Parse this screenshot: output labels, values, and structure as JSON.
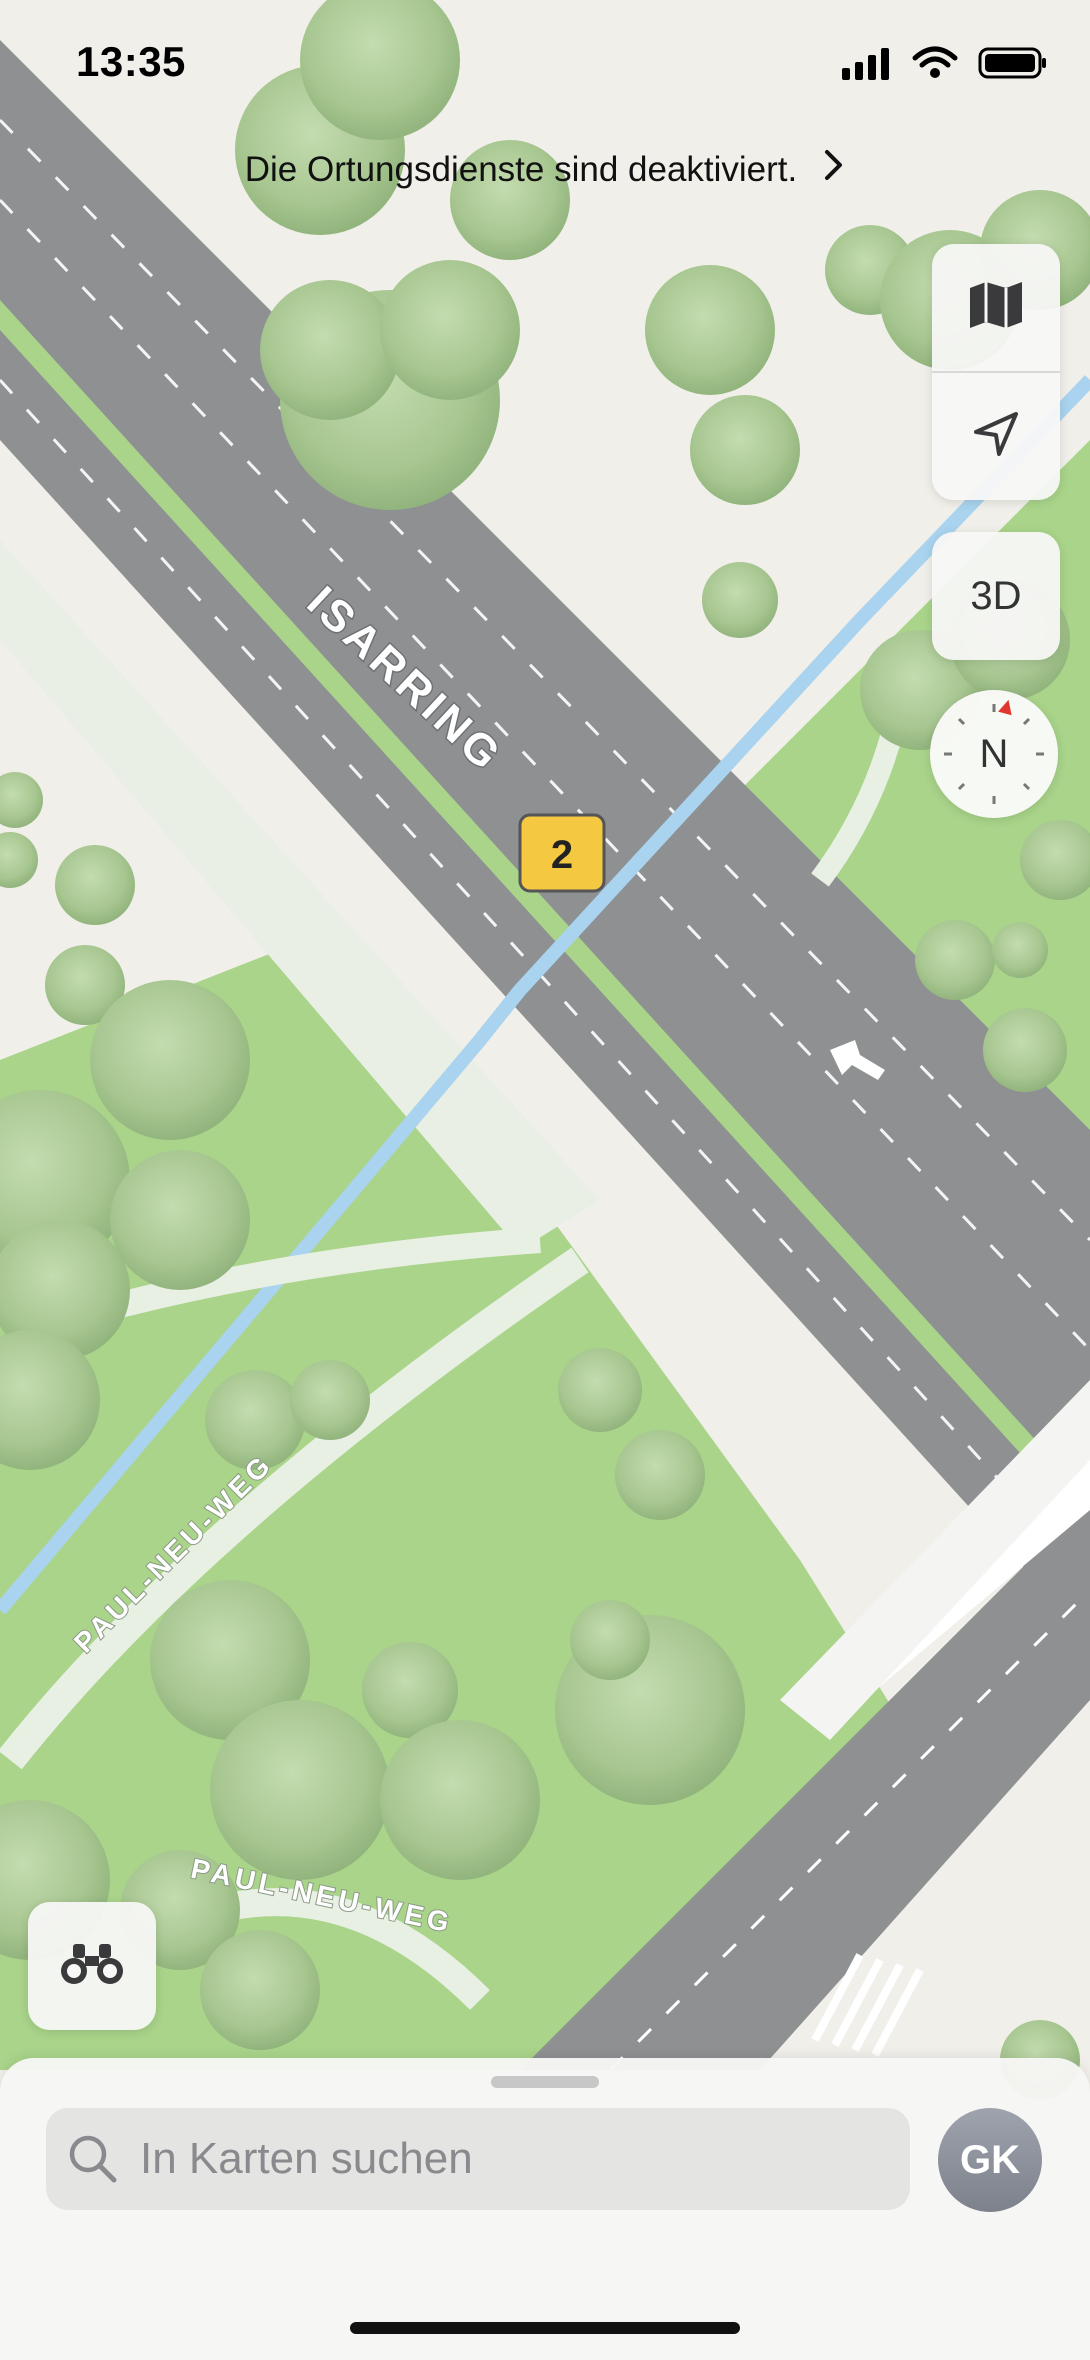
{
  "status_bar": {
    "time": "13:35"
  },
  "banner": {
    "text": "Die Ortungsdienste sind deaktiviert."
  },
  "map": {
    "road_name": "ISARRING",
    "route_shield": "2",
    "path_label_1": "PAUL-NEU-WEG",
    "path_label_2": "PAUL-NEU-WEG"
  },
  "controls": {
    "three_d_label": "3D",
    "compass_label": "N"
  },
  "search": {
    "placeholder": "In Karten suchen"
  },
  "profile": {
    "initials": "GK"
  },
  "icons": [
    "map-icon",
    "location-arrow-icon",
    "binoculars-icon",
    "search-icon",
    "signal-icon",
    "wifi-icon",
    "battery-icon",
    "chevron-right-icon"
  ]
}
